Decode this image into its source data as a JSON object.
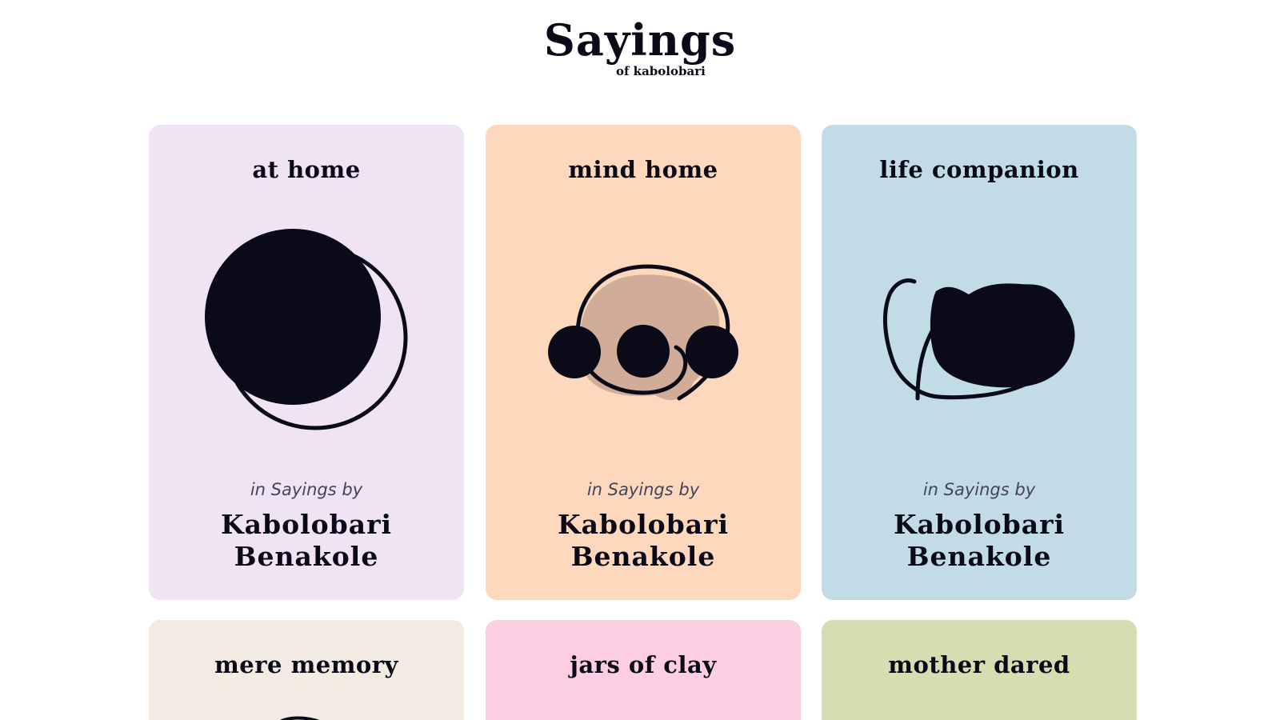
{
  "header": {
    "title": "Sayings",
    "subtitle": "of kabolobari"
  },
  "cards": [
    {
      "title": "at home",
      "in_text": "in Sayings by",
      "author_first": "Kabolobari",
      "author_last": "Benakole",
      "color": "#efe3f4",
      "icon": "circle-with-ring-icon"
    },
    {
      "title": "mind home",
      "in_text": "in Sayings by",
      "author_first": "Kabolobari",
      "author_last": "Benakole",
      "color": "#fdd8bc",
      "icon": "three-dots-spiral-icon"
    },
    {
      "title": "life companion",
      "in_text": "in Sayings by",
      "author_first": "Kabolobari",
      "author_last": "Benakole",
      "color": "#c1dce6",
      "icon": "bean-blob-icon"
    },
    {
      "title": "mere memory",
      "color": "#f3ebe1"
    },
    {
      "title": "jars of clay",
      "color": "#fdcde2"
    },
    {
      "title": "mother dared",
      "color": "#d8dcb1"
    }
  ],
  "colors": {
    "ink": "#0a0a19",
    "muted": "#43465a",
    "spiral_fill": "#d1ad99"
  }
}
